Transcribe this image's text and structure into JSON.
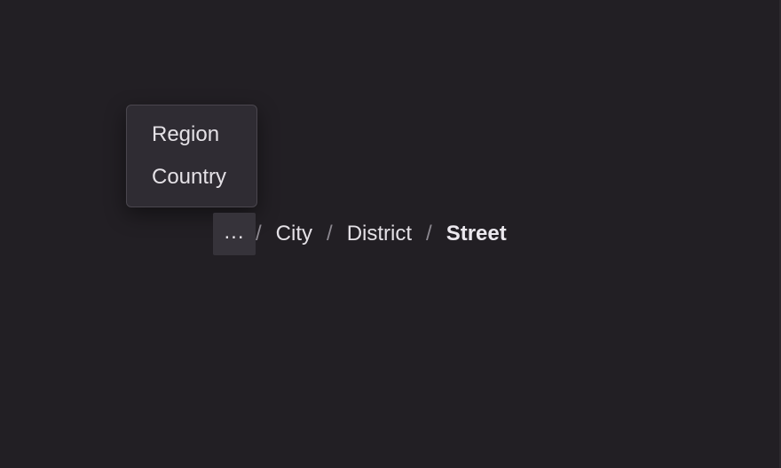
{
  "breadcrumb": {
    "ellipsis": "...",
    "separator": "/",
    "items": [
      {
        "label": "City"
      },
      {
        "label": "District"
      }
    ],
    "current": "Street"
  },
  "overflow_menu": {
    "items": [
      {
        "label": "Region"
      },
      {
        "label": "Country"
      }
    ]
  },
  "colors": {
    "background": "#221f24",
    "menu_background": "#2f2c33",
    "text": "#e4e1e6",
    "separator": "#8c8890"
  }
}
